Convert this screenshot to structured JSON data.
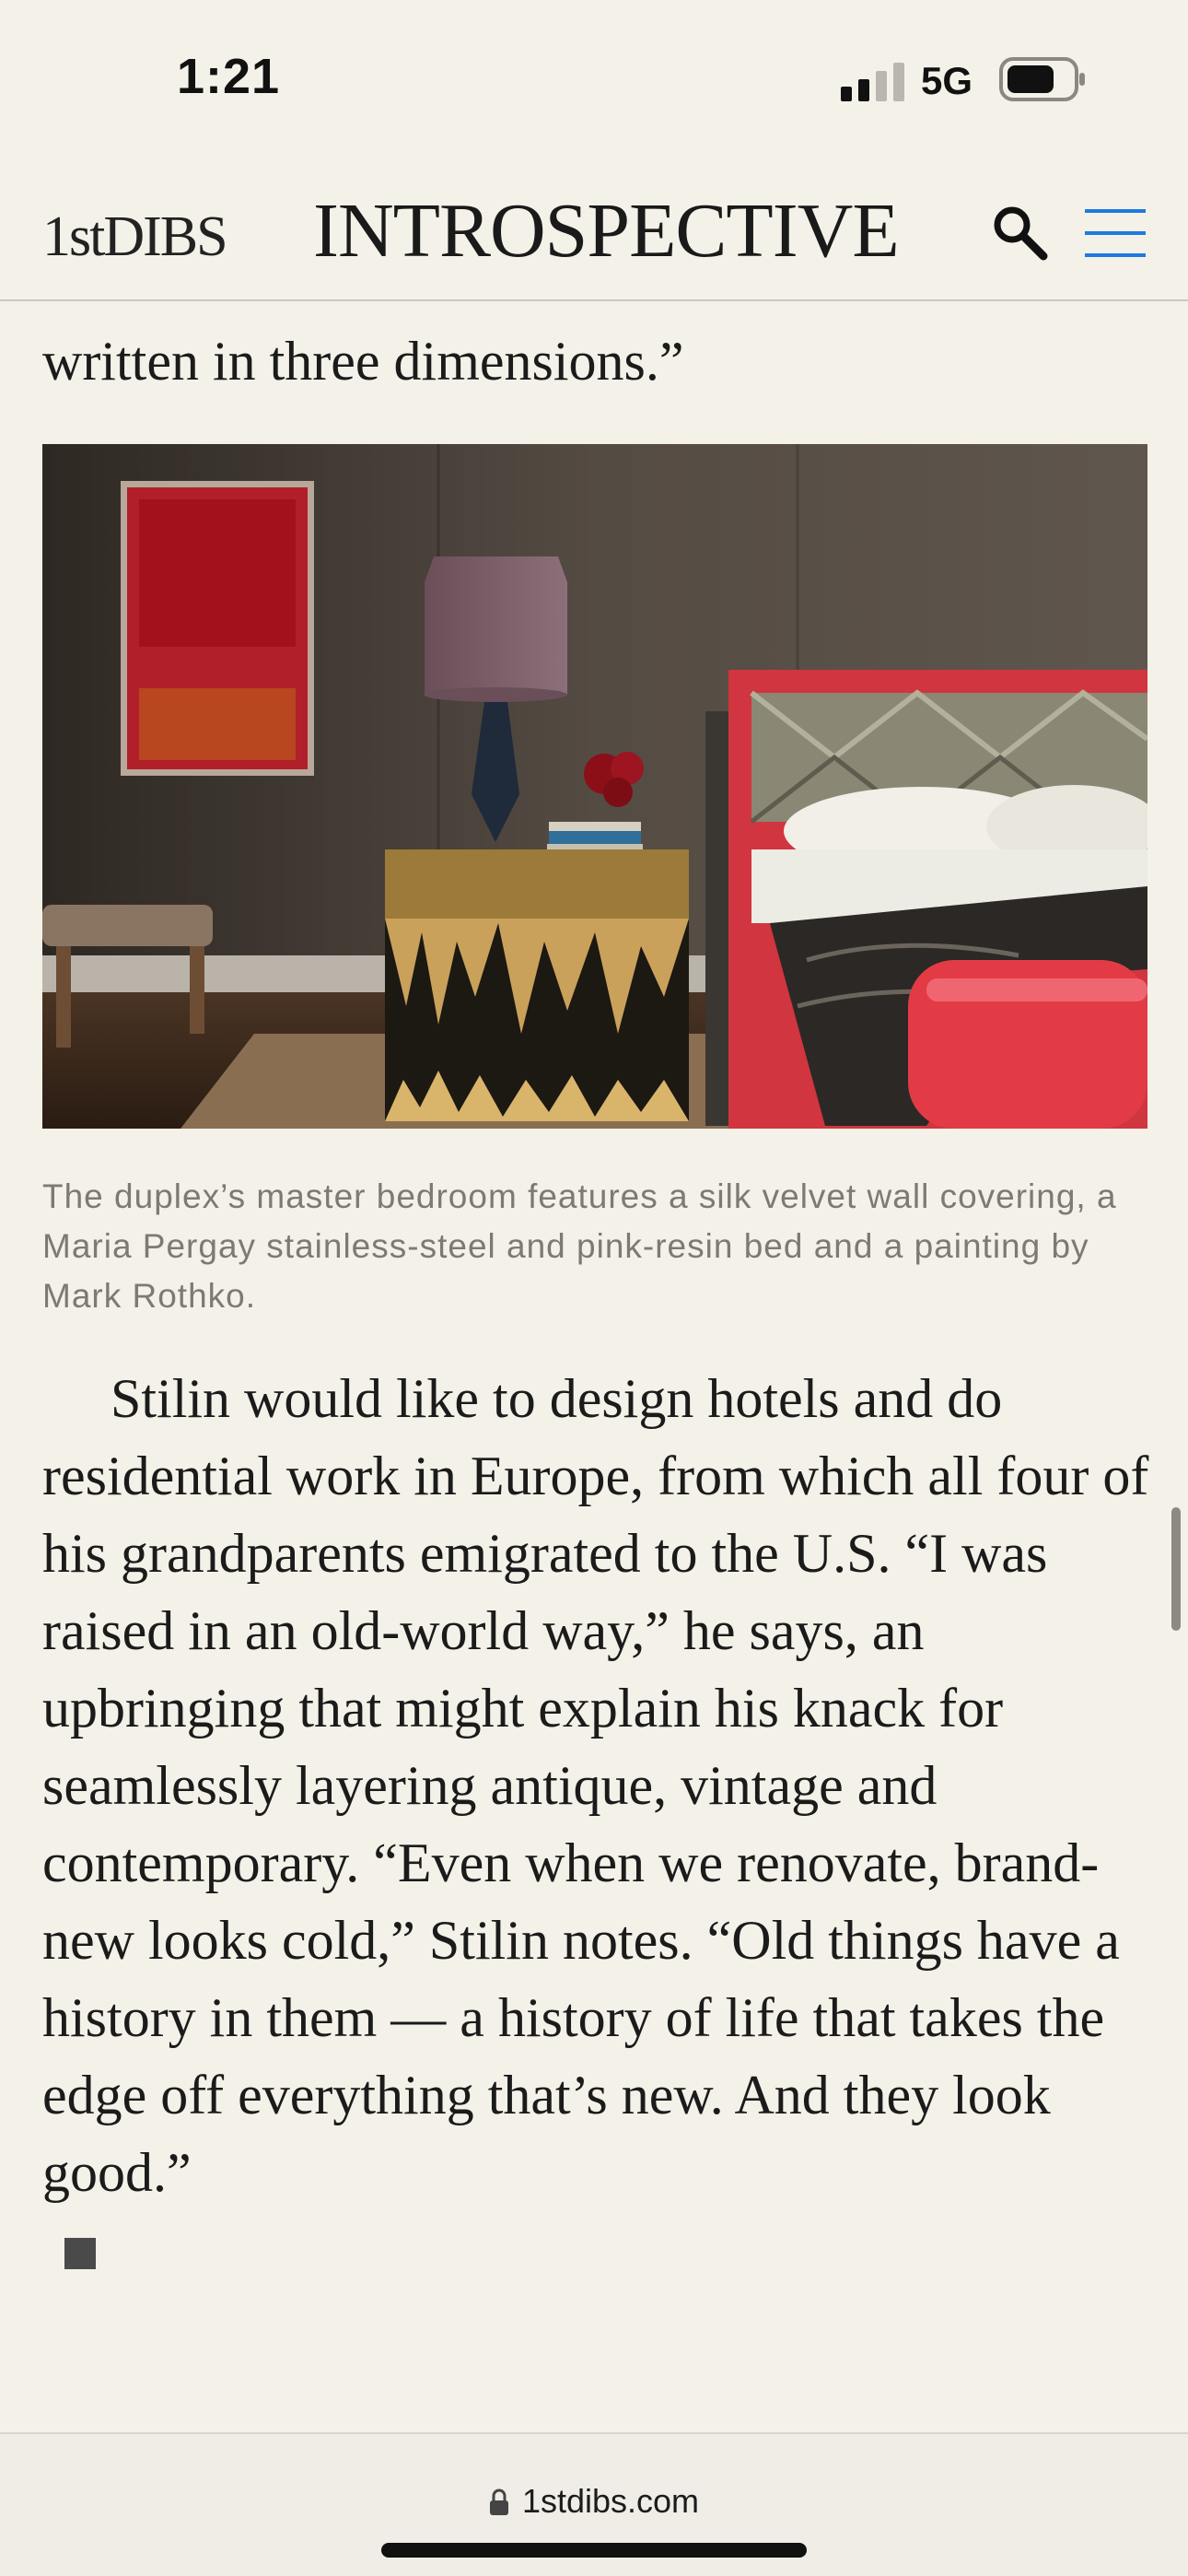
{
  "status_bar": {
    "time": "1:21",
    "network": "5G"
  },
  "header": {
    "logo": "1stDIBS",
    "title": "INTROSPECTIVE",
    "accent_color": "#1f7ae0"
  },
  "article": {
    "previous_paragraph_tail": "written in three dimensions.”",
    "image_caption": "The duplex’s master bedroom features a silk velvet wall covering, a Maria Pergay stainless-steel and pink-resin bed and a painting by Mark Rothko.",
    "paragraph": "Stilin would like to design hotels and do residential work in Europe, from which all four of his grandparents emigrated to the U.S. “I was raised in an old-world way,” he says, an upbringing that might explain his knack for seamlessly layering antique, vintage and contemporary. “Even when we renovate, brand-new looks cold,” Stilin notes. “Old things have a history in them — a history of life that takes the edge off everything that’s new. And they look good.”"
  },
  "browser": {
    "url": "1stdibs.com"
  }
}
